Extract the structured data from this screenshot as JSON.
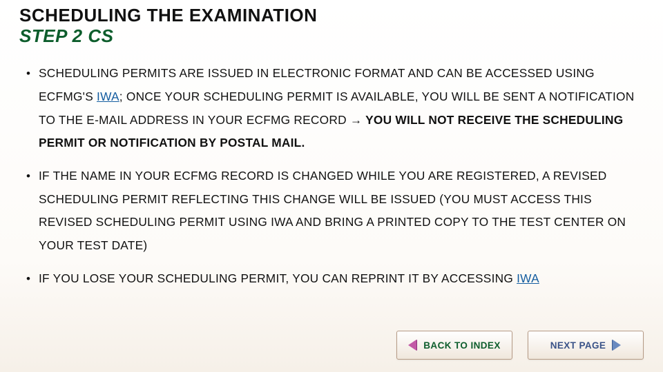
{
  "slide": {
    "title": "SCHEDULING THE EXAMINATION",
    "subtitle": "STEP 2 CS",
    "bullets": [
      {
        "pre": "SCHEDULING PERMITS ARE ISSUED IN ELECTRONIC FORMAT AND CAN BE ACCESSED USING ECFMG'S ",
        "link": "IWA",
        "mid": "; ONCE YOUR SCHEDULING PERMIT IS AVAILABLE, YOU WILL BE SENT A NOTIFICATION TO THE E-MAIL ADDRESS IN YOUR ECFMG RECORD ",
        "arrow": "→",
        "bold": " YOU WILL NOT RECEIVE THE SCHEDULING PERMIT OR NOTIFICATION BY POSTAL MAIL."
      },
      {
        "text": "IF THE NAME IN YOUR ECFMG RECORD IS CHANGED WHILE YOU ARE REGISTERED, A REVISED SCHEDULING PERMIT REFLECTING THIS CHANGE WILL BE ISSUED (YOU MUST ACCESS THIS REVISED SCHEDULING PERMIT USING IWA AND BRING A PRINTED COPY TO THE TEST CENTER ON YOUR TEST DATE)"
      },
      {
        "pre": "IF YOU LOSE YOUR SCHEDULING PERMIT, YOU CAN REPRINT IT BY ACCESSING ",
        "link": "IWA"
      }
    ],
    "nav": {
      "back": "BACK TO INDEX",
      "next": "NEXT PAGE"
    }
  }
}
